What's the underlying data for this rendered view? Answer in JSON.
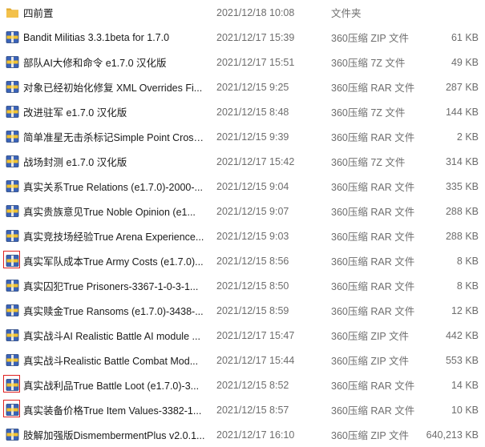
{
  "colors": {
    "folder": "#f3c14b",
    "archive_blue": "#3a63b8",
    "archive_yellow": "#f2c230",
    "highlight_box": "#e02020"
  },
  "files": [
    {
      "name": "四前置",
      "date": "2021/12/18 10:08",
      "type": "文件夹",
      "size": "",
      "icon": "folder-icon",
      "marked": false
    },
    {
      "name": "Bandit Militias 3.3.1beta for 1.7.0",
      "date": "2021/12/17 15:39",
      "type": "360压缩 ZIP 文件",
      "size": "61 KB",
      "icon": "archive-icon",
      "marked": false
    },
    {
      "name": "部队AI大修和命令 e1.7.0 汉化版",
      "date": "2021/12/17 15:51",
      "type": "360压缩 7Z 文件",
      "size": "49 KB",
      "icon": "archive-icon",
      "marked": false
    },
    {
      "name": "对象已经初始化修复 XML Overrides Fi...",
      "date": "2021/12/15 9:25",
      "type": "360压缩 RAR 文件",
      "size": "287 KB",
      "icon": "archive-icon",
      "marked": false
    },
    {
      "name": "改进驻军 e1.7.0 汉化版",
      "date": "2021/12/15 8:48",
      "type": "360压缩 7Z 文件",
      "size": "144 KB",
      "icon": "archive-icon",
      "marked": false
    },
    {
      "name": "简单准星无击杀标记Simple Point Cross...",
      "date": "2021/12/15 9:39",
      "type": "360压缩 RAR 文件",
      "size": "2 KB",
      "icon": "archive-icon",
      "marked": false
    },
    {
      "name": "战场封测 e1.7.0 汉化版",
      "date": "2021/12/17 15:42",
      "type": "360压缩 7Z 文件",
      "size": "314 KB",
      "icon": "archive-icon",
      "marked": false
    },
    {
      "name": "真实关系True Relations (e1.7.0)-2000-...",
      "date": "2021/12/15 9:04",
      "type": "360压缩 RAR 文件",
      "size": "335 KB",
      "icon": "archive-icon",
      "marked": false
    },
    {
      "name": "真实贵族意见True Noble Opinion (e1...",
      "date": "2021/12/15 9:07",
      "type": "360压缩 RAR 文件",
      "size": "288 KB",
      "icon": "archive-icon",
      "marked": false
    },
    {
      "name": "真实竞技场经验True Arena Experience...",
      "date": "2021/12/15 9:03",
      "type": "360压缩 RAR 文件",
      "size": "288 KB",
      "icon": "archive-icon",
      "marked": false
    },
    {
      "name": "真实军队成本True Army Costs (e1.7.0)...",
      "date": "2021/12/15 8:56",
      "type": "360压缩 RAR 文件",
      "size": "8 KB",
      "icon": "archive-icon",
      "marked": true
    },
    {
      "name": "真实囚犯True Prisoners-3367-1-0-3-1...",
      "date": "2021/12/15 8:50",
      "type": "360压缩 RAR 文件",
      "size": "8 KB",
      "icon": "archive-icon",
      "marked": false
    },
    {
      "name": "真实赎金True Ransoms (e1.7.0)-3438-...",
      "date": "2021/12/15 8:59",
      "type": "360压缩 RAR 文件",
      "size": "12 KB",
      "icon": "archive-icon",
      "marked": false
    },
    {
      "name": "真实战斗AI Realistic Battle AI module ...",
      "date": "2021/12/17 15:47",
      "type": "360压缩 ZIP 文件",
      "size": "442 KB",
      "icon": "archive-icon",
      "marked": false
    },
    {
      "name": "真实战斗Realistic Battle Combat Mod...",
      "date": "2021/12/17 15:44",
      "type": "360压缩 ZIP 文件",
      "size": "553 KB",
      "icon": "archive-icon",
      "marked": false
    },
    {
      "name": "真实战利品True Battle Loot (e1.7.0)-3...",
      "date": "2021/12/15 8:52",
      "type": "360压缩 RAR 文件",
      "size": "14 KB",
      "icon": "archive-icon",
      "marked": true
    },
    {
      "name": "真实装备价格True Item Values-3382-1...",
      "date": "2021/12/15 8:57",
      "type": "360压缩 RAR 文件",
      "size": "10 KB",
      "icon": "archive-icon",
      "marked": true
    },
    {
      "name": "肢解加强版DismembermentPlus v2.0.1...",
      "date": "2021/12/17 16:10",
      "type": "360压缩 ZIP 文件",
      "size": "640,213 KB",
      "icon": "archive-icon",
      "marked": false
    }
  ]
}
